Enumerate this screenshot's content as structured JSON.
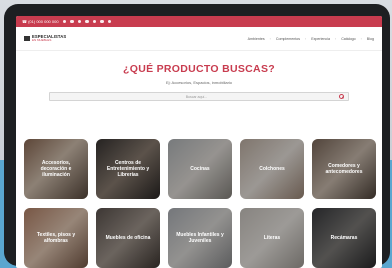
{
  "topbar": {
    "phone": "☎ (01) 000 000 000",
    "social_icons": [
      "facebook-icon",
      "twitter-icon",
      "instagram-icon",
      "pinterest-icon",
      "linkedin-icon",
      "youtube-icon",
      "whatsapp-icon"
    ]
  },
  "header": {
    "logo_text": "ESPECIALISTAS",
    "logo_sub": "EN MUEBLES",
    "nav": [
      "Ambientes",
      "Complementos",
      "Experiencia",
      "Catálogo",
      "Blog"
    ]
  },
  "hero": {
    "title": "¿QUÉ PRODUCTO BUSCAS?",
    "subtitle": "Ej: Accesorios, Espacios, inmobiliario",
    "search_placeholder": "Buscar aquí..."
  },
  "categories": [
    {
      "label": "Accesorios, decoración e iluminación"
    },
    {
      "label": "Centros de Entretenimiento y Librerías"
    },
    {
      "label": "Cocinas"
    },
    {
      "label": "Colchones"
    },
    {
      "label": "Comedores y antecomedores"
    },
    {
      "label": "Textiles, pisos y alfombras"
    },
    {
      "label": "Muebles de oficina"
    },
    {
      "label": "Muebles Infantiles y Juveniles"
    },
    {
      "label": "Literas"
    },
    {
      "label": "Recámaras"
    }
  ],
  "colors": {
    "accent": "#c83c4f",
    "tablet_bezel": "#1d1f22"
  }
}
